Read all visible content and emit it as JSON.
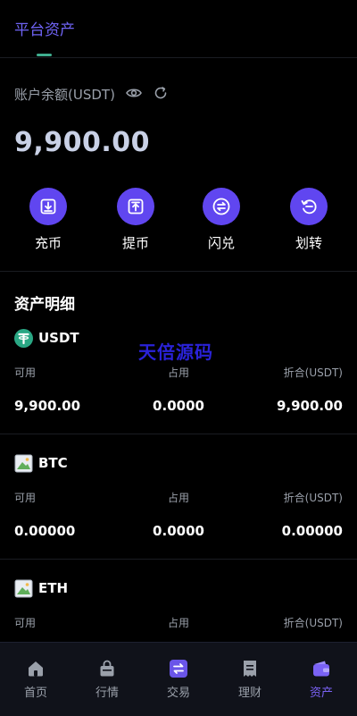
{
  "header": {
    "title": "平台资产"
  },
  "balance": {
    "label": "账户余额(USDT)",
    "value": "9,900.00"
  },
  "actions": [
    {
      "label": "充币",
      "icon": "deposit-icon"
    },
    {
      "label": "提币",
      "icon": "withdraw-icon"
    },
    {
      "label": "闪兑",
      "icon": "swap-icon"
    },
    {
      "label": "划转",
      "icon": "transfer-icon"
    }
  ],
  "section": {
    "title": "资产明细"
  },
  "watermark": "天倍源码",
  "assets": [
    {
      "name": "USDT",
      "available_label": "可用",
      "occupied_label": "占用",
      "equiv_label": "折合(USDT)",
      "available": "9,900.00",
      "occupied": "0.0000",
      "equiv": "9,900.00"
    },
    {
      "name": "BTC",
      "available_label": "可用",
      "occupied_label": "占用",
      "equiv_label": "折合(USDT)",
      "available": "0.00000",
      "occupied": "0.0000",
      "equiv": "0.00000"
    },
    {
      "name": "ETH",
      "available_label": "可用",
      "occupied_label": "占用",
      "equiv_label": "折合(USDT)",
      "available": "",
      "occupied": "",
      "equiv": ""
    }
  ],
  "nav": [
    {
      "label": "首页",
      "icon": "home-icon"
    },
    {
      "label": "行情",
      "icon": "market-icon"
    },
    {
      "label": "交易",
      "icon": "trade-icon"
    },
    {
      "label": "理财",
      "icon": "finance-icon"
    },
    {
      "label": "资产",
      "icon": "wallet-icon",
      "active": true
    }
  ],
  "colors": {
    "accent": "#6046f0",
    "accent_text": "#6f63f4",
    "tab_indicator": "#3fae8f",
    "tether_green": "#2aa784"
  }
}
